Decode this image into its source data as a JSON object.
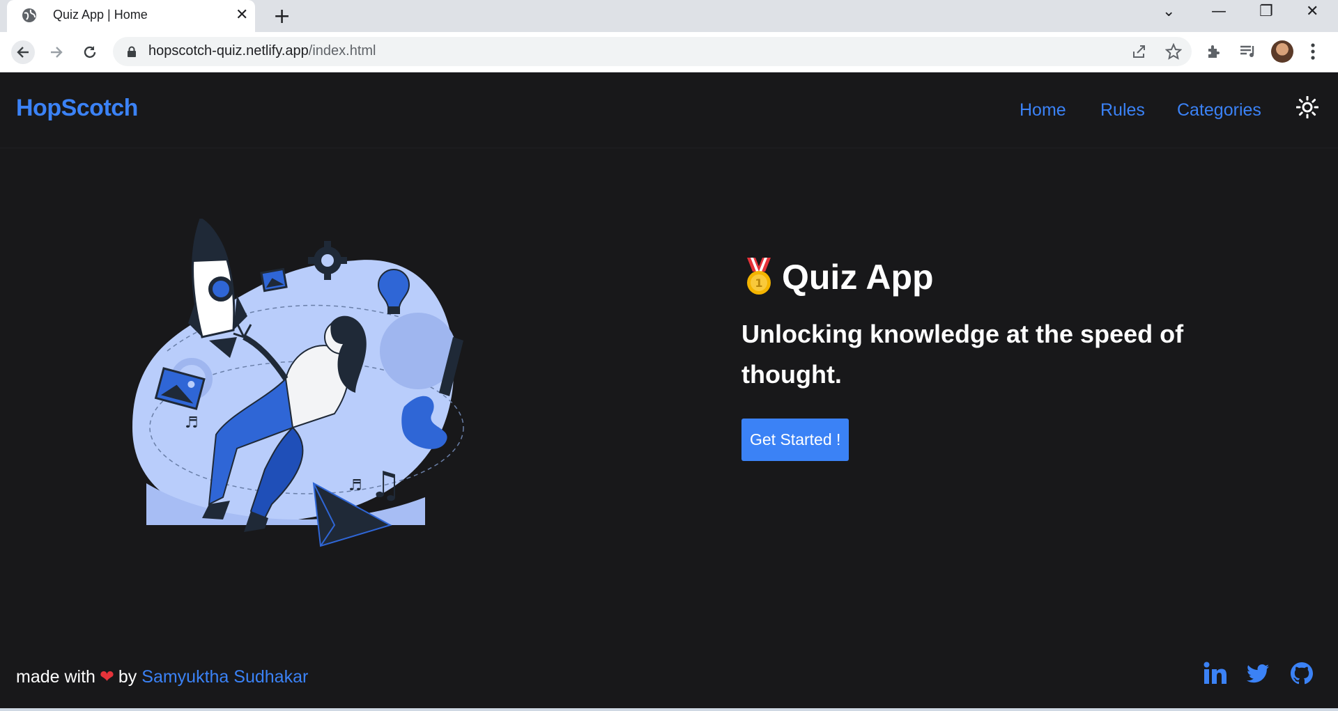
{
  "browser": {
    "tab_title": "Quiz App | Home",
    "url_host": "hopscotch-quiz.netlify.app",
    "url_path": "/index.html"
  },
  "navbar": {
    "brand": "HopScotch",
    "links": [
      "Home",
      "Rules",
      "Categories"
    ]
  },
  "hero": {
    "title": "Quiz App",
    "subtitle": "Unlocking knowledge at the speed of thought.",
    "cta_label": "Get Started !"
  },
  "footer": {
    "made_with": "made with",
    "by": "by",
    "author": "Samyuktha Sudhakar"
  },
  "colors": {
    "accent": "#3b82f6",
    "background": "#18181a",
    "heart": "#e5333a"
  },
  "icons": [
    "globe-icon",
    "close-icon",
    "plus-icon",
    "chevron-down-icon",
    "minimize-icon",
    "restore-icon",
    "window-close-icon",
    "back-icon",
    "forward-icon",
    "reload-icon",
    "lock-icon",
    "share-icon",
    "star-icon",
    "extensions-icon",
    "media-icon",
    "menu-icon",
    "sun-icon",
    "medal-icon",
    "heart-icon",
    "linkedin-icon",
    "twitter-icon",
    "github-icon"
  ]
}
